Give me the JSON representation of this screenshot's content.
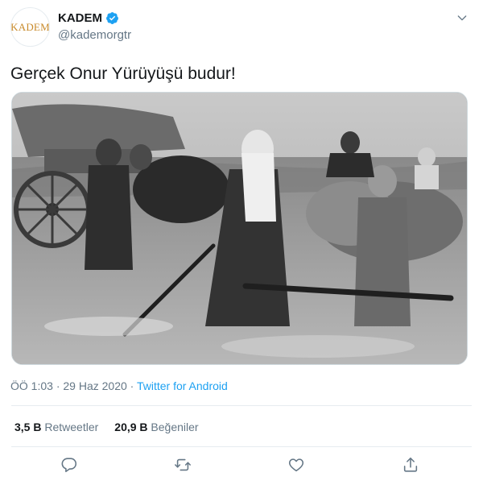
{
  "author": {
    "avatar_text": "KADEM",
    "display_name": "KADEM",
    "handle": "@kademorgtr",
    "verified": true
  },
  "tweet": {
    "text": "Gerçek Onur Yürüyüşü budur!",
    "time": "ÖÖ 1:03",
    "separator": "·",
    "date": "29 Haz 2020",
    "source": "Twitter for Android"
  },
  "stats": {
    "retweets_count": "3,5 B",
    "retweets_label": "Retweetler",
    "likes_count": "20,9 B",
    "likes_label": "Beğeniler"
  },
  "colors": {
    "accent": "#1da1f2",
    "secondary_text": "#657786",
    "divider": "#e6ecf0",
    "logo": "#c88a2a"
  },
  "icons": {
    "menu": "chevron-down-icon",
    "reply": "reply-icon",
    "retweet": "retweet-icon",
    "like": "heart-icon",
    "share": "share-icon"
  }
}
